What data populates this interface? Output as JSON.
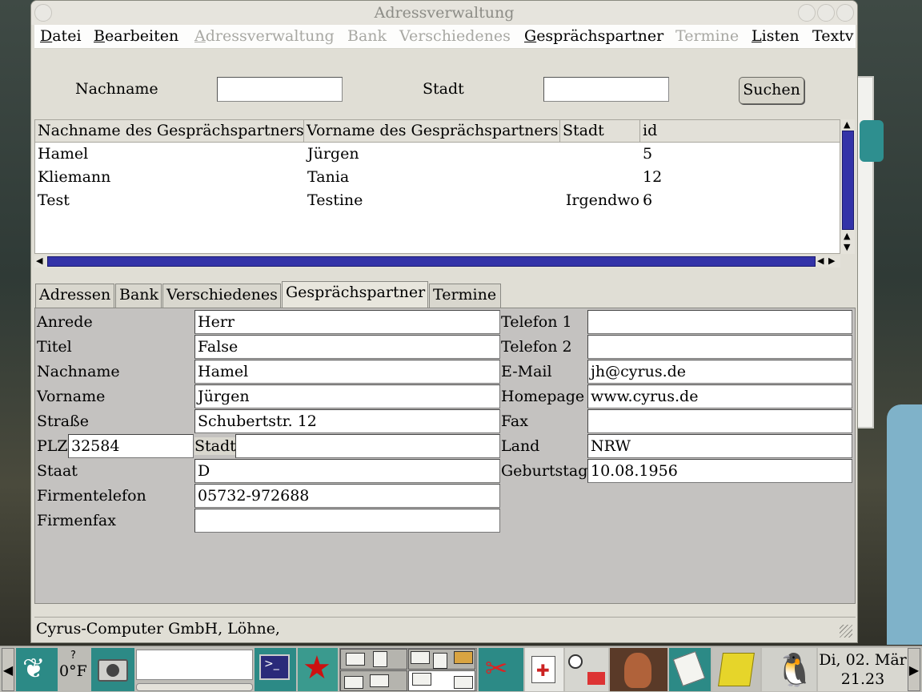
{
  "window": {
    "title": "Adressverwaltung"
  },
  "menubar": {
    "items": [
      {
        "first": "D",
        "rest": "atei",
        "disabled": false
      },
      {
        "first": "B",
        "rest": "earbeiten",
        "disabled": false
      },
      {
        "first": "A",
        "rest": "dressverwaltung",
        "disabled": true
      },
      {
        "first": "",
        "rest": "Bank",
        "disabled": true
      },
      {
        "first": "",
        "rest": "Verschiedenes",
        "disabled": true
      },
      {
        "first": "G",
        "rest": "esprächspartner",
        "disabled": false
      },
      {
        "first": "",
        "rest": "Termine",
        "disabled": true
      },
      {
        "first": "L",
        "rest": "isten",
        "disabled": false
      },
      {
        "first": "",
        "rest": "Textv",
        "disabled": false
      }
    ]
  },
  "search": {
    "nachname_label": "Nachname",
    "nachname_value": "",
    "stadt_label": "Stadt",
    "stadt_value": "",
    "button_label": "Suchen"
  },
  "table": {
    "columns": [
      "Nachname des Gesprächspartners",
      "Vorname des Gesprächspartners",
      "Stadt",
      "id"
    ],
    "rows": [
      [
        "Hamel",
        "Jürgen",
        "",
        "5"
      ],
      [
        "Kliemann",
        "Tania",
        "",
        "12"
      ],
      [
        "Test",
        "Testine",
        "Irgendwo",
        "6"
      ]
    ]
  },
  "tabs": {
    "items": [
      "Adressen",
      "Bank",
      "Verschiedenes",
      "Gesprächspartner",
      "Termine"
    ],
    "active": "Gesprächspartner"
  },
  "form": {
    "anrede": {
      "label": "Anrede",
      "value": "Herr"
    },
    "titel": {
      "label": "Titel",
      "value": "False"
    },
    "nachname": {
      "label": "Nachname",
      "value": "Hamel"
    },
    "vorname": {
      "label": "Vorname",
      "value": "Jürgen"
    },
    "strasse": {
      "label": "Straße",
      "value": "Schubertstr. 12"
    },
    "plz": {
      "label": "PLZ",
      "value": "32584"
    },
    "stadt": {
      "label": "Stadt",
      "value": ""
    },
    "staat": {
      "label": "Staat",
      "value": "D"
    },
    "firmentelefon": {
      "label": "Firmentelefon",
      "value": "05732-972688"
    },
    "firmenfax": {
      "label": "Firmenfax",
      "value": ""
    },
    "telefon1": {
      "label": "Telefon 1",
      "value": ""
    },
    "telefon2": {
      "label": "Telefon 2",
      "value": ""
    },
    "email": {
      "label": "E-Mail",
      "value": "jh@cyrus.de"
    },
    "homepage": {
      "label": "Homepage",
      "value": "www.cyrus.de"
    },
    "fax": {
      "label": "Fax",
      "value": ""
    },
    "land": {
      "label": "Land",
      "value": "NRW"
    },
    "geburtstag": {
      "label": "Geburtstag",
      "value": "10.08.1956"
    }
  },
  "status": {
    "text": "Cyrus-Computer GmbH, Löhne,"
  },
  "taskbar": {
    "weather_temp": "0°F",
    "weather_unknown": "?",
    "clock_date": "Di, 02. Mär",
    "clock_time": "21.23"
  },
  "colors": {
    "scroll_thumb": "#3333a8",
    "panel": "#c4c2c0",
    "window": "#e0ded5",
    "taskbar_tile": "#2c8a86"
  },
  "icons": [
    "gnome-foot-icon",
    "camera-icon",
    "terminal-icon",
    "star-icon",
    "swiss-knife-icon",
    "config-icon",
    "search-icon",
    "nebula-icon",
    "notepad-icon",
    "sticky-note-icon",
    "penguin-icon"
  ]
}
